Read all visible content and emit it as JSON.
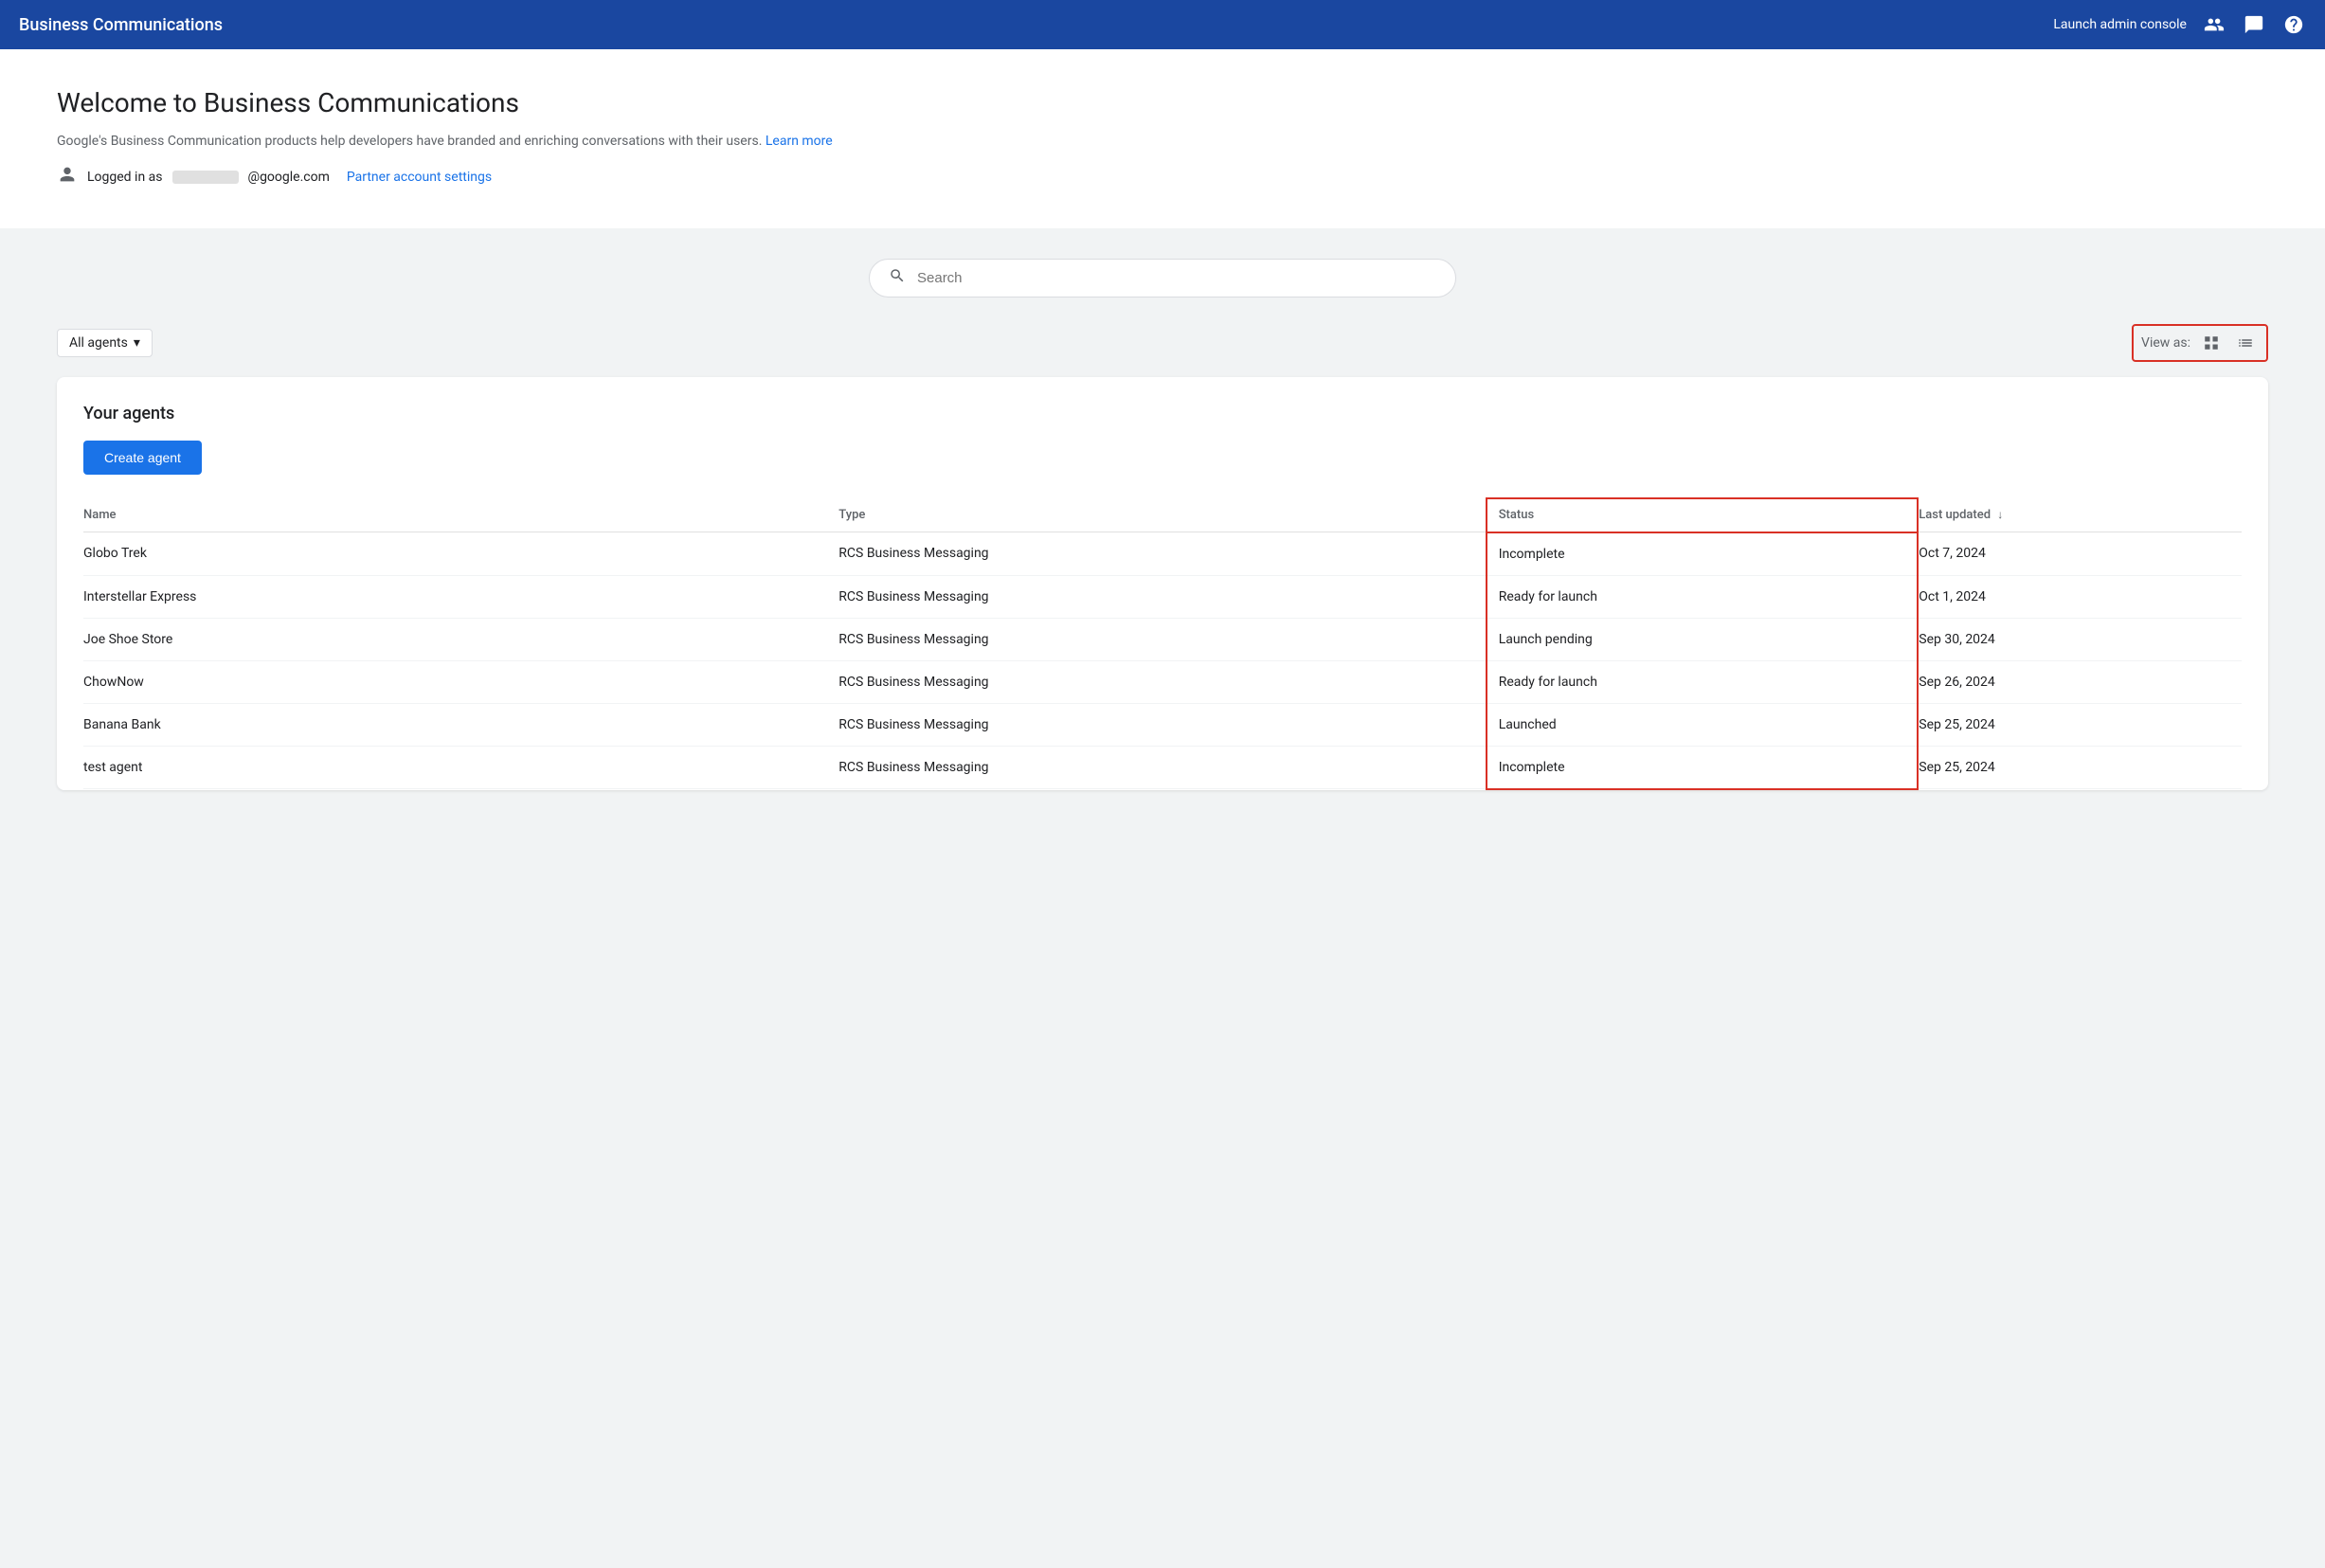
{
  "header": {
    "title": "Business Communications",
    "launch_label": "Launch admin console",
    "icons": {
      "people": "👥",
      "chat": "💬",
      "help": "?"
    }
  },
  "welcome": {
    "title": "Welcome to Business Communications",
    "description": "Google's Business Communication products help developers have branded and enriching conversations with their users.",
    "learn_more_label": "Learn more",
    "logged_in_prefix": "Logged in as",
    "email_suffix": "@google.com",
    "partner_settings_label": "Partner account settings"
  },
  "search": {
    "placeholder": "Search"
  },
  "toolbar": {
    "filter_label": "All agents",
    "view_as_label": "View as:"
  },
  "agents": {
    "section_title": "Your agents",
    "create_button": "Create agent",
    "table": {
      "columns": [
        {
          "key": "name",
          "label": "Name"
        },
        {
          "key": "type",
          "label": "Type"
        },
        {
          "key": "status",
          "label": "Status",
          "highlighted": true
        },
        {
          "key": "last_updated",
          "label": "Last updated",
          "sortable": true,
          "sort_dir": "desc"
        }
      ],
      "rows": [
        {
          "name": "Globo Trek",
          "type": "RCS Business Messaging",
          "status": "Incomplete",
          "last_updated": "Oct 7, 2024"
        },
        {
          "name": "Interstellar Express",
          "type": "RCS Business Messaging",
          "status": "Ready for launch",
          "last_updated": "Oct 1, 2024"
        },
        {
          "name": "Joe Shoe Store",
          "type": "RCS Business Messaging",
          "status": "Launch pending",
          "last_updated": "Sep 30, 2024"
        },
        {
          "name": "ChowNow",
          "type": "RCS Business Messaging",
          "status": "Ready for launch",
          "last_updated": "Sep 26, 2024"
        },
        {
          "name": "Banana Bank",
          "type": "RCS Business Messaging",
          "status": "Launched",
          "last_updated": "Sep 25, 2024"
        },
        {
          "name": "test agent",
          "type": "RCS Business Messaging",
          "status": "Incomplete",
          "last_updated": "Sep 25, 2024"
        }
      ]
    }
  }
}
